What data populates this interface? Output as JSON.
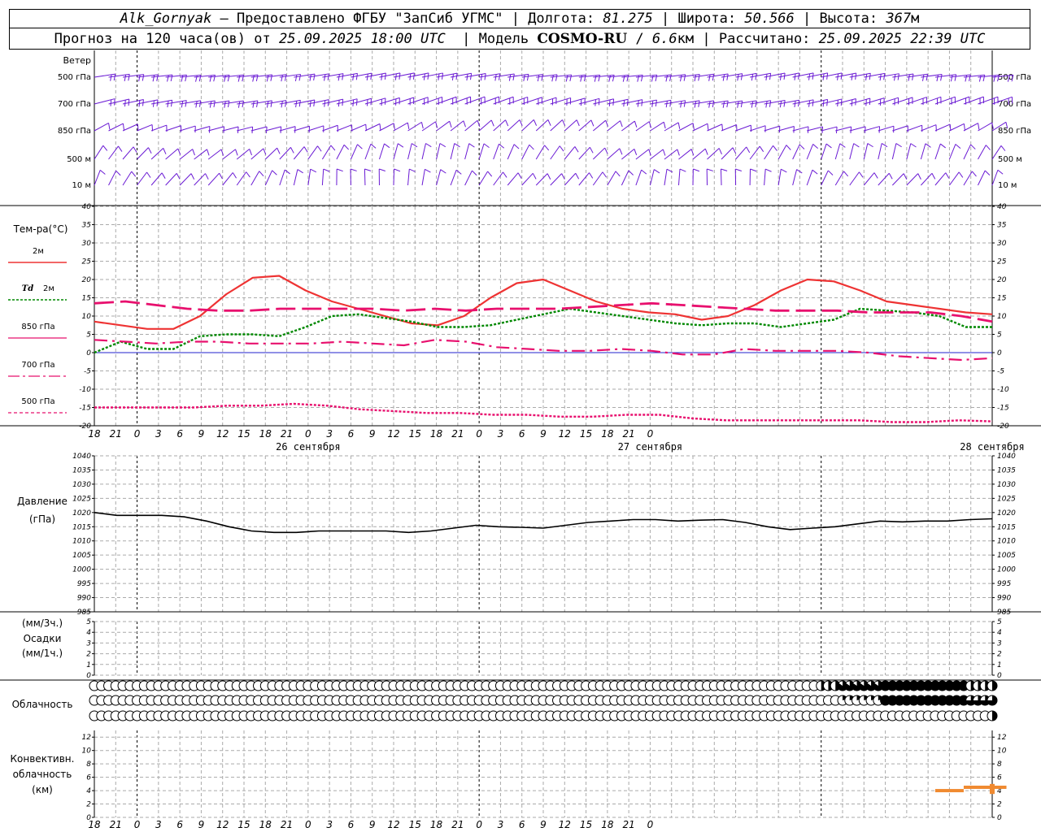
{
  "header": {
    "station": "Alk_Gornyak",
    "provider": "Предоставлено ФГБУ \"ЗапСиб УГМС\"",
    "lon_label": "Долгота:",
    "lon": "81.275",
    "lat_label": "Широта:",
    "lat": "50.566",
    "alt_label": "Высота:",
    "alt": "367",
    "alt_unit": "м",
    "forecast_prefix": "Прогноз на 120 часа(ов) от",
    "forecast_start": "25.09.2025 18:00 UTC",
    "model_label": "Модель",
    "model": "COSMO-RU",
    "resolution": "6.6",
    "res_unit": "км",
    "calc_label": "Рассчитано:",
    "calc_time": "25.09.2025 22:39 UTC"
  },
  "colors": {
    "t2m": "#ee3333",
    "td": "#008800",
    "t850": "#e8106e",
    "t700": "#e8106e",
    "t500": "#e8106e",
    "pressure": "#000000",
    "wind": "#6a1ad4",
    "conv": "#f08a30",
    "zero": "#2222cc"
  },
  "time_ticks": [
    "18",
    "21",
    "0",
    "3",
    "6",
    "9",
    "12",
    "15",
    "18",
    "21",
    "0",
    "3",
    "6",
    "9",
    "12",
    "15",
    "18",
    "21",
    "0",
    "3",
    "6",
    "9",
    "12",
    "15",
    "18",
    "21",
    "0"
  ],
  "dates": [
    {
      "hour": 30,
      "label": "26 сентября"
    },
    {
      "hour": 78,
      "label": "27 сентября"
    },
    {
      "hour": 126,
      "label": "28 сентября"
    }
  ],
  "wind": {
    "title": "Ветер",
    "levels": [
      "500 гПа",
      "700 гПа",
      "850 гПа",
      "500 м",
      "10 м"
    ]
  },
  "temp": {
    "title": "Тем-ра(°C)",
    "legend": [
      {
        "top": "2м",
        "key": "t2m"
      },
      {
        "top_italic": "Td",
        "top": "2м",
        "key": "td"
      },
      {
        "top": "850 гПа",
        "key": "t850"
      },
      {
        "top": "700 гПа",
        "key": "t700"
      },
      {
        "top": "500 гПа",
        "key": "t500"
      }
    ],
    "yticks": [
      40,
      35,
      30,
      25,
      20,
      15,
      10,
      5,
      0,
      -5,
      -10,
      -15,
      -20
    ]
  },
  "pressure": {
    "title": "Давление",
    "unit": "(гПа)",
    "yticks": [
      1040,
      1035,
      1030,
      1025,
      1020,
      1015,
      1010,
      1005,
      1000,
      995,
      990,
      985
    ]
  },
  "precip": {
    "unit3": "(мм/3ч.)",
    "title": "Осадки",
    "unit1": "(мм/1ч.)",
    "yticks": [
      5,
      4,
      3,
      2,
      1,
      0
    ]
  },
  "clouds": {
    "title": "Облачность"
  },
  "conv": {
    "title_lines": [
      "Конвективн.",
      "облачность",
      "(км)"
    ],
    "yticks": [
      12,
      10,
      8,
      6,
      4,
      2,
      0
    ]
  },
  "chart_data": [
    {
      "type": "line",
      "title": "Температура",
      "x": [
        0,
        3,
        6,
        9,
        12,
        15,
        18,
        21,
        24,
        27,
        30,
        33,
        36,
        39,
        42,
        45,
        48,
        51,
        54,
        57,
        60,
        63,
        66,
        69,
        72,
        75,
        78,
        81,
        84,
        87,
        90,
        93,
        96,
        99,
        102,
        105,
        108,
        111,
        114,
        117,
        120,
        123,
        126
      ],
      "series": [
        {
          "name": "2м",
          "values": [
            8.5,
            7.5,
            6.5,
            6.5,
            10,
            16,
            20.5,
            21,
            17,
            14,
            12,
            10,
            8,
            7.5,
            10,
            15,
            19,
            20,
            17,
            14,
            12,
            11,
            10.5,
            9,
            10,
            13,
            17,
            20,
            19.5,
            17,
            14,
            13,
            12,
            11,
            10.5
          ]
        },
        {
          "name": "Td 2м",
          "values": [
            0,
            3,
            1,
            1,
            4.5,
            5,
            5,
            4.5,
            7,
            10,
            10.5,
            9.5,
            8.5,
            7,
            7,
            7.5,
            9,
            10.5,
            12,
            11,
            10,
            9,
            8,
            7.5,
            8,
            8,
            7,
            8,
            9,
            12,
            11.5,
            11,
            10,
            7,
            7
          ]
        },
        {
          "name": "850 гПа",
          "values": [
            13.5,
            14,
            13,
            12,
            11.5,
            11.5,
            12,
            12,
            12,
            12,
            11.5,
            12,
            11.5,
            12,
            12,
            12,
            12.5,
            13,
            13.5,
            13,
            12.5,
            12,
            11.5,
            11.5,
            11.5,
            11,
            11,
            11,
            10,
            8.5
          ]
        },
        {
          "name": "700 гПа",
          "values": [
            3.5,
            3,
            2.5,
            3,
            3,
            2.5,
            2.5,
            2.5,
            3,
            2.5,
            2,
            3.5,
            3,
            1.5,
            1,
            0.5,
            0.5,
            1,
            0.5,
            -0.5,
            -0.5,
            1,
            0.5,
            0.5,
            0.5,
            0,
            -1,
            -1.5,
            -2,
            -1.5
          ]
        },
        {
          "name": "500 гПа",
          "values": [
            -15,
            -15,
            -15,
            -15,
            -14.5,
            -14.5,
            -14,
            -14.5,
            -15.5,
            -16,
            -16.5,
            -16.5,
            -17,
            -17,
            -17.5,
            -17.5,
            -17,
            -17,
            -18,
            -18.5,
            -18.5,
            -18.5,
            -18.5,
            -18.5,
            -19,
            -19,
            -18.5,
            -18.8
          ]
        }
      ],
      "ylim": [
        -20,
        40
      ]
    },
    {
      "type": "line",
      "title": "Давление",
      "unit": "гПа",
      "x": [
        0,
        3,
        6,
        9,
        12,
        15,
        18,
        21,
        24,
        27,
        30,
        33,
        36,
        39,
        42,
        45,
        48,
        51,
        54,
        57,
        60,
        63,
        66,
        69,
        72,
        75,
        78,
        81,
        84,
        87,
        90,
        93,
        96,
        99,
        102,
        105,
        108,
        111,
        114,
        117,
        120,
        123,
        126
      ],
      "series": [
        {
          "name": "Давление",
          "values": [
            1020,
            1019,
            1019,
            1019,
            1018.5,
            1017,
            1015,
            1013.5,
            1013,
            1013,
            1013.5,
            1013.5,
            1013.5,
            1013.5,
            1013,
            1013.5,
            1014.5,
            1015.5,
            1015,
            1014.8,
            1014.5,
            1015.5,
            1016.5,
            1017,
            1017.5,
            1017.5,
            1017,
            1017.3,
            1017.5,
            1016.5,
            1015,
            1014,
            1014.5,
            1015,
            1016,
            1017,
            1016.7,
            1017,
            1017,
            1017.5,
            1017.8
          ]
        }
      ],
      "ylim": [
        985,
        1040
      ]
    },
    {
      "type": "bar",
      "title": "Осадки",
      "values": [],
      "ylim": [
        0,
        5
      ]
    },
    {
      "type": "bar",
      "title": "Конвективная облачность",
      "x": [
        120,
        122,
        124,
        126,
        128
      ],
      "values": [
        4,
        4,
        4.5,
        4.5,
        4.5
      ],
      "ylim": [
        0,
        13
      ]
    }
  ]
}
